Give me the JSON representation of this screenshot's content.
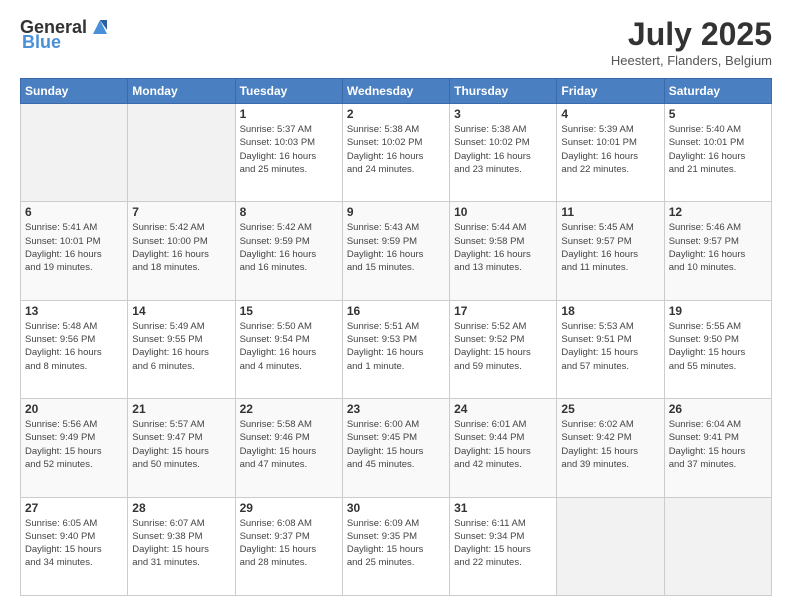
{
  "header": {
    "logo_general": "General",
    "logo_blue": "Blue",
    "month": "July 2025",
    "location": "Heestert, Flanders, Belgium"
  },
  "weekdays": [
    "Sunday",
    "Monday",
    "Tuesday",
    "Wednesday",
    "Thursday",
    "Friday",
    "Saturday"
  ],
  "weeks": [
    [
      {
        "day": "",
        "info": ""
      },
      {
        "day": "",
        "info": ""
      },
      {
        "day": "1",
        "info": "Sunrise: 5:37 AM\nSunset: 10:03 PM\nDaylight: 16 hours\nand 25 minutes."
      },
      {
        "day": "2",
        "info": "Sunrise: 5:38 AM\nSunset: 10:02 PM\nDaylight: 16 hours\nand 24 minutes."
      },
      {
        "day": "3",
        "info": "Sunrise: 5:38 AM\nSunset: 10:02 PM\nDaylight: 16 hours\nand 23 minutes."
      },
      {
        "day": "4",
        "info": "Sunrise: 5:39 AM\nSunset: 10:01 PM\nDaylight: 16 hours\nand 22 minutes."
      },
      {
        "day": "5",
        "info": "Sunrise: 5:40 AM\nSunset: 10:01 PM\nDaylight: 16 hours\nand 21 minutes."
      }
    ],
    [
      {
        "day": "6",
        "info": "Sunrise: 5:41 AM\nSunset: 10:01 PM\nDaylight: 16 hours\nand 19 minutes."
      },
      {
        "day": "7",
        "info": "Sunrise: 5:42 AM\nSunset: 10:00 PM\nDaylight: 16 hours\nand 18 minutes."
      },
      {
        "day": "8",
        "info": "Sunrise: 5:42 AM\nSunset: 9:59 PM\nDaylight: 16 hours\nand 16 minutes."
      },
      {
        "day": "9",
        "info": "Sunrise: 5:43 AM\nSunset: 9:59 PM\nDaylight: 16 hours\nand 15 minutes."
      },
      {
        "day": "10",
        "info": "Sunrise: 5:44 AM\nSunset: 9:58 PM\nDaylight: 16 hours\nand 13 minutes."
      },
      {
        "day": "11",
        "info": "Sunrise: 5:45 AM\nSunset: 9:57 PM\nDaylight: 16 hours\nand 11 minutes."
      },
      {
        "day": "12",
        "info": "Sunrise: 5:46 AM\nSunset: 9:57 PM\nDaylight: 16 hours\nand 10 minutes."
      }
    ],
    [
      {
        "day": "13",
        "info": "Sunrise: 5:48 AM\nSunset: 9:56 PM\nDaylight: 16 hours\nand 8 minutes."
      },
      {
        "day": "14",
        "info": "Sunrise: 5:49 AM\nSunset: 9:55 PM\nDaylight: 16 hours\nand 6 minutes."
      },
      {
        "day": "15",
        "info": "Sunrise: 5:50 AM\nSunset: 9:54 PM\nDaylight: 16 hours\nand 4 minutes."
      },
      {
        "day": "16",
        "info": "Sunrise: 5:51 AM\nSunset: 9:53 PM\nDaylight: 16 hours\nand 1 minute."
      },
      {
        "day": "17",
        "info": "Sunrise: 5:52 AM\nSunset: 9:52 PM\nDaylight: 15 hours\nand 59 minutes."
      },
      {
        "day": "18",
        "info": "Sunrise: 5:53 AM\nSunset: 9:51 PM\nDaylight: 15 hours\nand 57 minutes."
      },
      {
        "day": "19",
        "info": "Sunrise: 5:55 AM\nSunset: 9:50 PM\nDaylight: 15 hours\nand 55 minutes."
      }
    ],
    [
      {
        "day": "20",
        "info": "Sunrise: 5:56 AM\nSunset: 9:49 PM\nDaylight: 15 hours\nand 52 minutes."
      },
      {
        "day": "21",
        "info": "Sunrise: 5:57 AM\nSunset: 9:47 PM\nDaylight: 15 hours\nand 50 minutes."
      },
      {
        "day": "22",
        "info": "Sunrise: 5:58 AM\nSunset: 9:46 PM\nDaylight: 15 hours\nand 47 minutes."
      },
      {
        "day": "23",
        "info": "Sunrise: 6:00 AM\nSunset: 9:45 PM\nDaylight: 15 hours\nand 45 minutes."
      },
      {
        "day": "24",
        "info": "Sunrise: 6:01 AM\nSunset: 9:44 PM\nDaylight: 15 hours\nand 42 minutes."
      },
      {
        "day": "25",
        "info": "Sunrise: 6:02 AM\nSunset: 9:42 PM\nDaylight: 15 hours\nand 39 minutes."
      },
      {
        "day": "26",
        "info": "Sunrise: 6:04 AM\nSunset: 9:41 PM\nDaylight: 15 hours\nand 37 minutes."
      }
    ],
    [
      {
        "day": "27",
        "info": "Sunrise: 6:05 AM\nSunset: 9:40 PM\nDaylight: 15 hours\nand 34 minutes."
      },
      {
        "day": "28",
        "info": "Sunrise: 6:07 AM\nSunset: 9:38 PM\nDaylight: 15 hours\nand 31 minutes."
      },
      {
        "day": "29",
        "info": "Sunrise: 6:08 AM\nSunset: 9:37 PM\nDaylight: 15 hours\nand 28 minutes."
      },
      {
        "day": "30",
        "info": "Sunrise: 6:09 AM\nSunset: 9:35 PM\nDaylight: 15 hours\nand 25 minutes."
      },
      {
        "day": "31",
        "info": "Sunrise: 6:11 AM\nSunset: 9:34 PM\nDaylight: 15 hours\nand 22 minutes."
      },
      {
        "day": "",
        "info": ""
      },
      {
        "day": "",
        "info": ""
      }
    ]
  ]
}
